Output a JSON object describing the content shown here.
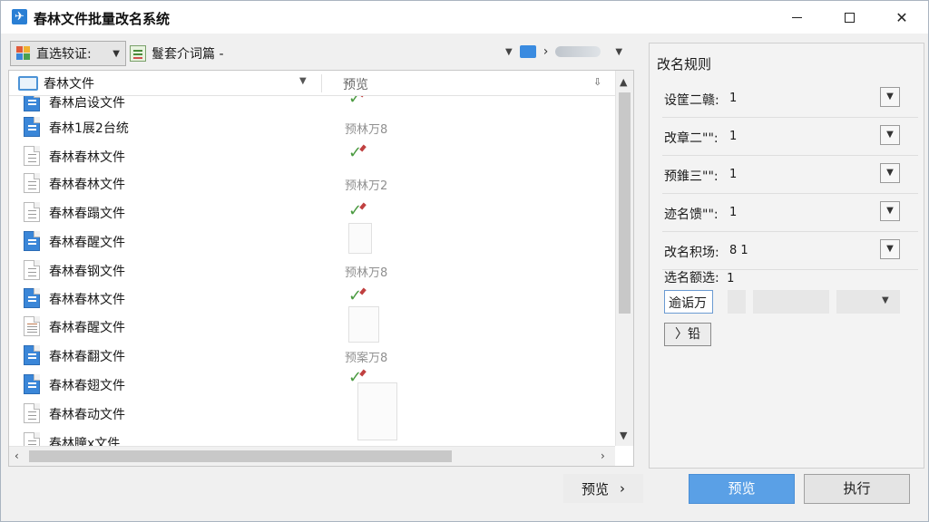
{
  "window": {
    "title": "春林文件批量改名系统"
  },
  "toolbar": {
    "dropdown_label": "直选较证:",
    "tool2_label": "鬘套介词篇 -"
  },
  "file_list": {
    "col_name": "春林文件",
    "col_preview": "预览",
    "rows": [
      {
        "name": "春林启设文件",
        "icon": "blue",
        "preview": ""
      },
      {
        "name": "春林1展2台统",
        "icon": "blue",
        "preview": "预林万8"
      },
      {
        "name": "春林春林文件",
        "icon": "gray",
        "preview": ""
      },
      {
        "name": "春林春林文件",
        "icon": "gray",
        "preview": "预林万2"
      },
      {
        "name": "春林春蹋文件",
        "icon": "gray",
        "preview": ""
      },
      {
        "name": "春林春醒文件",
        "icon": "blue",
        "preview": ""
      },
      {
        "name": "春林春钢文件",
        "icon": "gray",
        "preview": "预林万8"
      },
      {
        "name": "春林春林文件",
        "icon": "blue",
        "preview": ""
      },
      {
        "name": "春林春醒文件",
        "icon": "lines",
        "preview": ""
      },
      {
        "name": "春林春翻文件",
        "icon": "blue",
        "preview": "预案万8"
      },
      {
        "name": "春林春翅文件",
        "icon": "blue",
        "preview": ""
      },
      {
        "name": "春林春动文件",
        "icon": "gray",
        "preview": ""
      },
      {
        "name": "春林瞳x文件",
        "icon": "gray",
        "preview": ""
      }
    ]
  },
  "rules": {
    "title": "改名规则",
    "items": [
      {
        "label": "设筐二赣:",
        "value": "1"
      },
      {
        "label": "改章二\"\":",
        "value": "1"
      },
      {
        "label": "预錐三\"\":",
        "value": "1"
      },
      {
        "label": "迹名馈\"\":",
        "value": "1"
      },
      {
        "label": "改名积场:",
        "value": "8  1"
      }
    ],
    "last_label": "选名额选:",
    "last_value": "1",
    "combo_text": "逾诟万",
    "small_button": "〉铅"
  },
  "footer": {
    "preview_link": "预览",
    "primary_button": "预览",
    "secondary_button": "执行"
  }
}
